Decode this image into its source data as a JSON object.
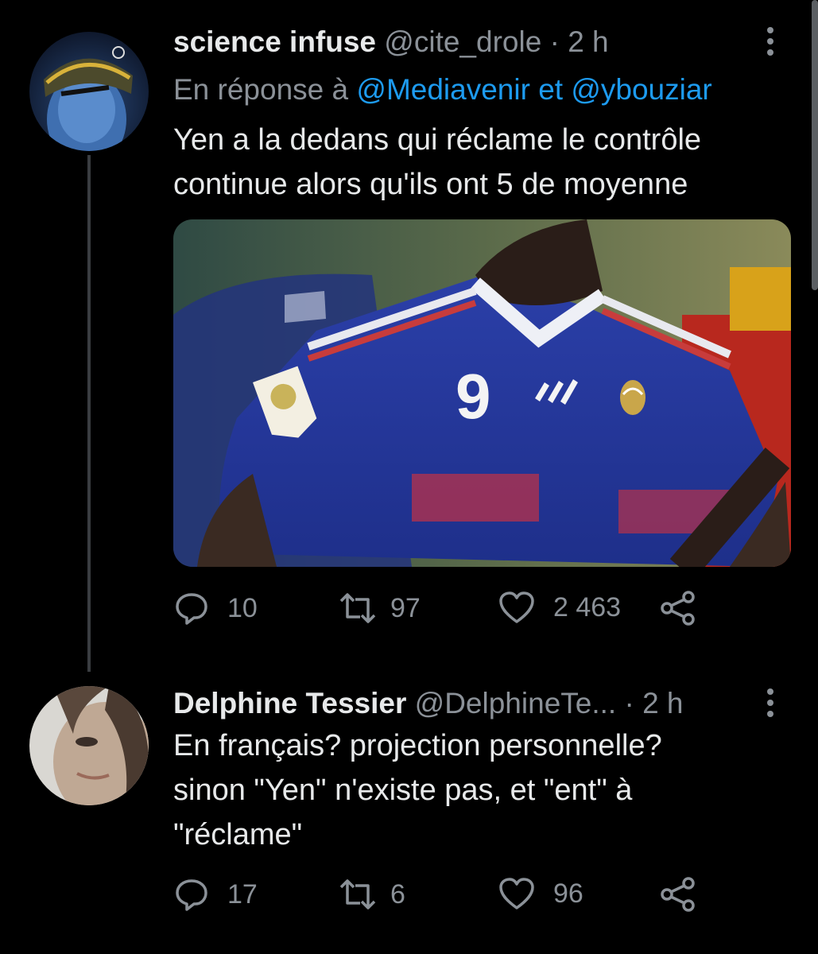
{
  "tweets": [
    {
      "name": "science infuse",
      "handle": "@cite_drole",
      "sep": "·",
      "time": "2 h",
      "reply_prefix": "En réponse à",
      "reply_mention_1": "@Mediavenir",
      "reply_joiner": "et",
      "reply_mention_2": "@ybouziar",
      "text_lines": [
        "Yen a la dedans qui réclame le contrôle",
        "continue alors qu'ils ont 5 de moyenne"
      ],
      "jersey_number": "9",
      "stats": {
        "replies": "10",
        "retweets": "97",
        "likes": "2 463"
      }
    },
    {
      "name": "Delphine Tessier",
      "handle": "@DelphineTe...",
      "sep": "·",
      "time": "2 h",
      "text_lines": [
        "En français? projection personnelle?",
        "sinon \"Yen\" n'existe pas, et \"ent\" à",
        "\"réclame\""
      ],
      "stats": {
        "replies": "17",
        "retweets": "6",
        "likes": "96"
      }
    }
  ],
  "icons": {
    "reply": "reply-icon",
    "retweet": "retweet-icon",
    "like": "heart-icon",
    "share": "share-icon",
    "more": "more-vertical-icon"
  },
  "colors": {
    "background": "#000000",
    "text": "#e7e9ea",
    "muted": "#8b9198",
    "link": "#1d9bf0",
    "thread_line": "#3a3d41"
  }
}
